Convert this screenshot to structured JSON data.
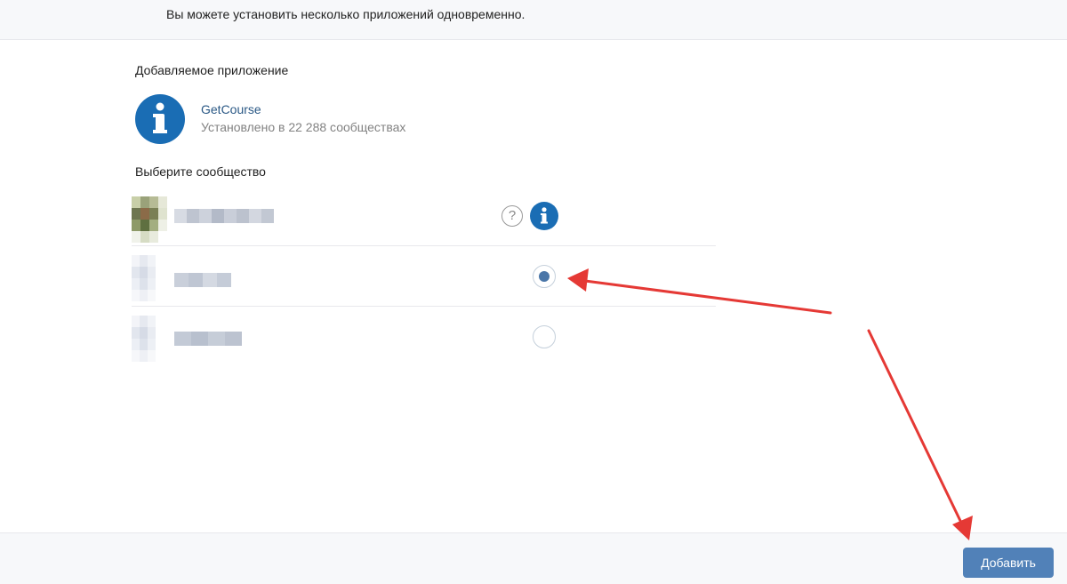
{
  "notice": "Вы можете установить несколько приложений одновременно.",
  "app_section": {
    "title": "Добавляемое приложение",
    "app_name": "GetCourse",
    "app_meta": "Установлено в 22 288 сообществах",
    "app_icon": "info-icon"
  },
  "community_section": {
    "title": "Выберите сообщество",
    "rows": [
      {
        "selected": false,
        "controls": [
          "help-icon",
          "info-icon"
        ]
      },
      {
        "selected": true,
        "controls": [
          "radio"
        ]
      },
      {
        "selected": false,
        "controls": [
          "radio"
        ]
      }
    ]
  },
  "footer": {
    "add_label": "Добавить"
  },
  "colors": {
    "accent": "#5181b8",
    "link": "#2a5885",
    "app_icon_bg": "#1a6db4",
    "annotation_arrow": "#e53935"
  }
}
